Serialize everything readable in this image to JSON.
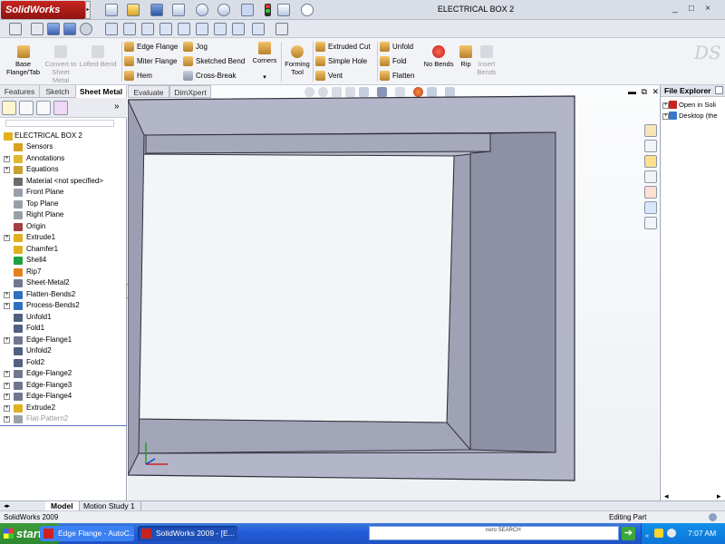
{
  "app": {
    "logo_text": "SolidWorks",
    "window_title": "ELECTRICAL BOX 2",
    "window_buttons": [
      "_",
      "□",
      "×"
    ],
    "icons": {
      "new": "new-document-icon",
      "open": "open-folder-icon",
      "save": "save-icon",
      "print": "print-icon",
      "undo": "undo-icon",
      "redo": "redo-icon",
      "select": "pointer-icon",
      "rebuild": "traffic-light-icon",
      "options": "options-icon",
      "zoom": "magnifier-icon"
    }
  },
  "ribbon": {
    "large": [
      {
        "label": "Base Flange/Tab",
        "disabled": false
      },
      {
        "label": "Convert to Sheet Metal",
        "disabled": true
      },
      {
        "label": "Lofted-Bend",
        "disabled": true
      }
    ],
    "col1": [
      "Edge Flange",
      "Miter Flange",
      "Hem"
    ],
    "col2": [
      "Jog",
      "Sketched Bend",
      "Cross-Break"
    ],
    "corners": "Corners",
    "forming_tool": "Forming Tool",
    "col3": [
      "Extruded Cut",
      "Simple Hole",
      "Vent"
    ],
    "col4": [
      "Unfold",
      "Fold",
      "Flatten"
    ],
    "no_bends": "No Bends",
    "rip": "Rip",
    "insert_bends": "Insert Bends",
    "ds_logo": "DS"
  },
  "tabs": [
    "Features",
    "Sketch",
    "Sheet Metal",
    "Evaluate",
    "DimXpert"
  ],
  "active_tab": "Sheet Metal",
  "tree": {
    "root": "ELECTRICAL BOX 2",
    "items": [
      {
        "label": "Sensors",
        "expand": false,
        "color": "#d9a21c"
      },
      {
        "label": "Annotations",
        "expand": true,
        "color": "#e0b830"
      },
      {
        "label": "Equations",
        "expand": true,
        "color": "#c8a030"
      },
      {
        "label": "Material <not specified>",
        "expand": false,
        "color": "#6b6b6b"
      },
      {
        "label": "Front Plane",
        "expand": false,
        "color": "#9aa0aa"
      },
      {
        "label": "Top Plane",
        "expand": false,
        "color": "#9aa0aa"
      },
      {
        "label": "Right Plane",
        "expand": false,
        "color": "#9aa0aa"
      },
      {
        "label": "Origin",
        "expand": false,
        "color": "#a04040"
      },
      {
        "label": "Extrude1",
        "expand": true,
        "color": "#e0b020"
      },
      {
        "label": "Chamfer1",
        "expand": false,
        "color": "#e0b020"
      },
      {
        "label": "Shell4",
        "expand": false,
        "color": "#20a040"
      },
      {
        "label": "Rip7",
        "expand": false,
        "color": "#e08020"
      },
      {
        "label": "Sheet-Metal2",
        "expand": false,
        "color": "#707890"
      },
      {
        "label": "Flatten-Bends2",
        "expand": true,
        "color": "#3070c0"
      },
      {
        "label": "Process-Bends2",
        "expand": true,
        "color": "#3070c0"
      },
      {
        "label": "Unfold1",
        "expand": false,
        "color": "#506080"
      },
      {
        "label": "Fold1",
        "expand": false,
        "color": "#506080"
      },
      {
        "label": "Edge-Flange1",
        "expand": true,
        "color": "#707890"
      },
      {
        "label": "Unfold2",
        "expand": false,
        "color": "#506080"
      },
      {
        "label": "Fold2",
        "expand": false,
        "color": "#506080"
      },
      {
        "label": "Edge-Flange2",
        "expand": true,
        "color": "#707890"
      },
      {
        "label": "Edge-Flange3",
        "expand": true,
        "color": "#707890"
      },
      {
        "label": "Edge-Flange4",
        "expand": true,
        "color": "#707890"
      },
      {
        "label": "Extrude2",
        "expand": true,
        "color": "#e0b020"
      },
      {
        "label": "Flat-Pattern2",
        "expand": true,
        "color": "#9aa0aa",
        "greyed": true
      }
    ]
  },
  "explorer": {
    "title": "File Explorer",
    "items": [
      "Open in Soli",
      "Desktop (the"
    ]
  },
  "bottom_tabs": [
    "Model",
    "Motion Study 1"
  ],
  "status": {
    "left": "SolidWorks 2009",
    "right": "Editing Part"
  },
  "taskbar": {
    "start": "start",
    "tasks": [
      "Edge Flange - AutoC...",
      "SolidWorks 2009 - [E..."
    ],
    "search_brand": "nero SEARCH",
    "clock": "7:07 AM"
  },
  "colors": {
    "part_face": "#b3b5c8",
    "part_edge": "#2e2f38",
    "part_bevel": "#8e90a6",
    "accent_red": "#c8241f",
    "taskbar_blue": "#245edb"
  }
}
